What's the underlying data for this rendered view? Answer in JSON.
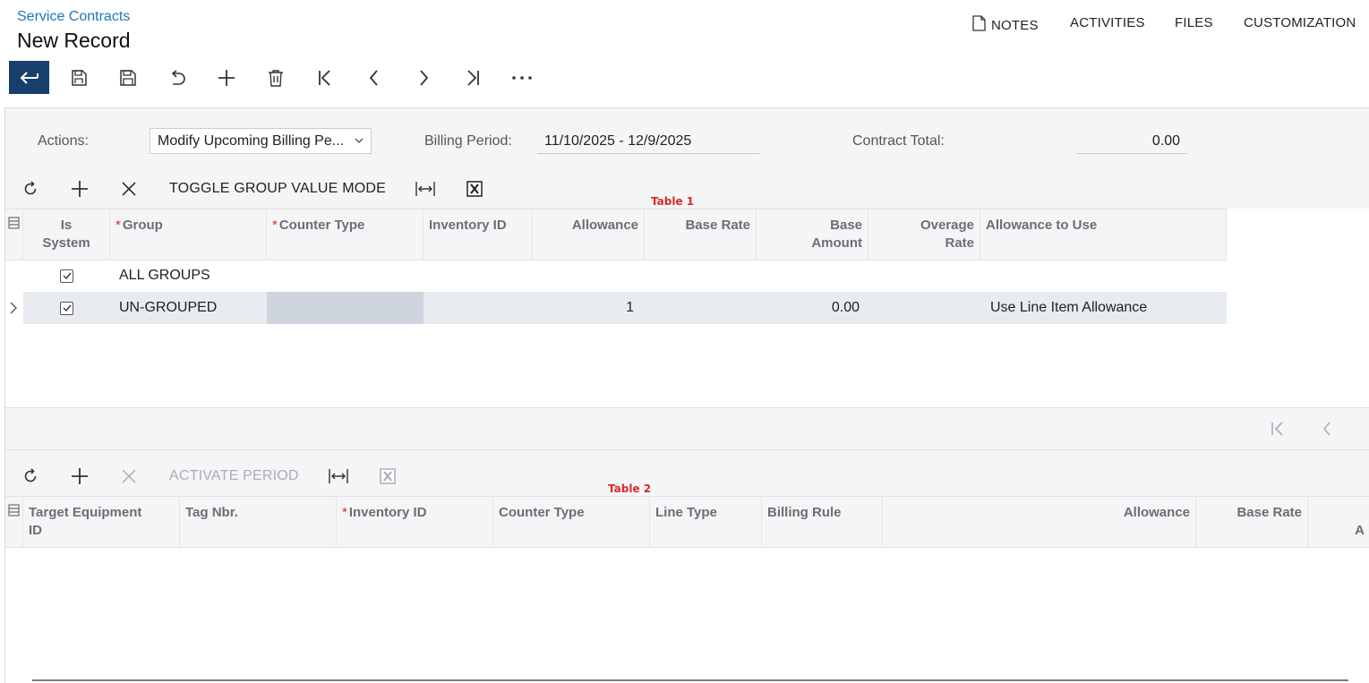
{
  "breadcrumb": "Service Contracts",
  "page_title": "New Record",
  "top_links": [
    "NOTES",
    "ACTIVITIES",
    "FILES",
    "CUSTOMIZATION"
  ],
  "form": {
    "actions_label": "Actions:",
    "actions_value": "Modify Upcoming Billing Pe...",
    "billing_period_label": "Billing Period:",
    "billing_period_value": "11/10/2025 - 12/9/2025",
    "contract_total_label": "Contract Total:",
    "contract_total_value": "0.00"
  },
  "table1": {
    "tag": "Table 1",
    "toolbar_action": "TOGGLE GROUP VALUE MODE",
    "columns": {
      "is_system_1": "Is",
      "is_system_2": "System",
      "group": "Group",
      "counter_type": "Counter Type",
      "inventory_id": "Inventory ID",
      "allowance": "Allowance",
      "base_rate": "Base Rate",
      "base_amount_1": "Base",
      "base_amount_2": "Amount",
      "overage_rate_1": "Overage",
      "overage_rate_2": "Rate",
      "allowance_to_use": "Allowance to Use"
    },
    "rows": [
      {
        "is_system": true,
        "group": "ALL GROUPS",
        "counter_type": "",
        "inventory_id": "",
        "allowance": "",
        "base_rate": "",
        "base_amount": "",
        "overage_rate": "",
        "allowance_to_use": ""
      },
      {
        "is_system": true,
        "group": "UN-GROUPED",
        "counter_type": "",
        "inventory_id": "",
        "allowance": "1",
        "base_rate": "",
        "base_amount": "0.00",
        "overage_rate": "",
        "allowance_to_use": "Use Line Item Allowance"
      }
    ]
  },
  "table2": {
    "tag": "Table 2",
    "toolbar_action": "ACTIVATE PERIOD",
    "columns": {
      "target_equipment_1": "Target Equipment",
      "target_equipment_2": "ID",
      "tag_nbr": "Tag Nbr.",
      "inventory_id": "Inventory ID",
      "counter_type": "Counter Type",
      "line_type": "Line Type",
      "billing_rule": "Billing Rule",
      "allowance": "Allowance",
      "base_rate": "Base Rate",
      "cut_off": "A"
    }
  },
  "colors": {
    "accent": "#173f6e",
    "link": "#1a78bf",
    "required": "#d92b2b",
    "selected_row": "#e8ebf0",
    "active_cell": "#cfd5df"
  }
}
